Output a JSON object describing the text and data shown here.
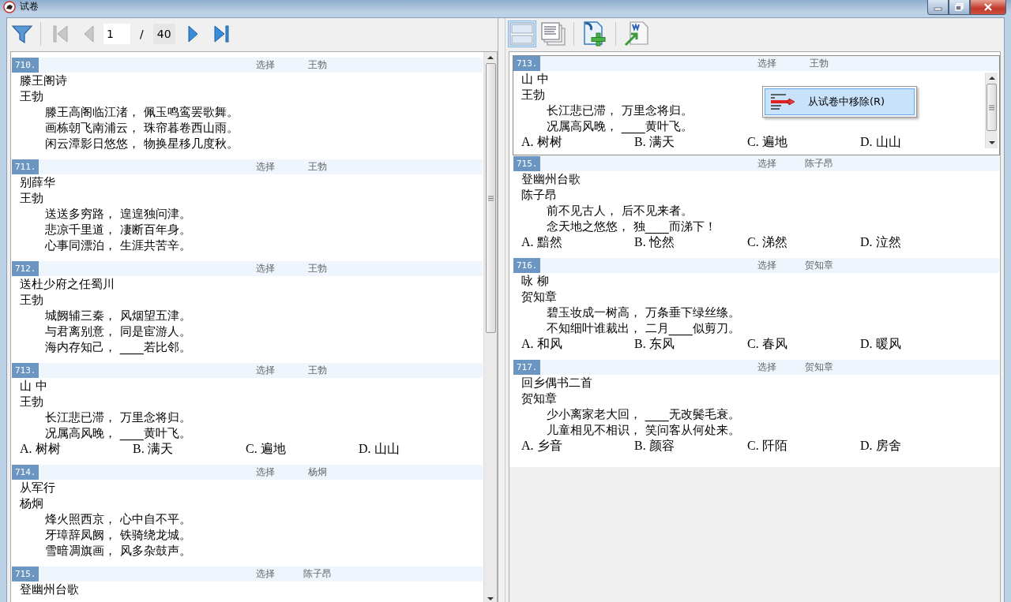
{
  "window": {
    "title": "试卷"
  },
  "left_toolbar": {
    "nav": [
      {
        "kind": "first",
        "disabled": true
      },
      {
        "kind": "prev",
        "disabled": true
      },
      {
        "kind": "next",
        "disabled": false
      },
      {
        "kind": "last",
        "disabled": false
      }
    ],
    "page": "1",
    "separator": "/",
    "page_count": "40"
  },
  "left_questions": [
    {
      "number": "710.",
      "type": "选择",
      "author": "王勃",
      "title": "滕王阁诗",
      "poet": "王勃",
      "lines": [
        "滕王高阁临江渚， 佩玉鸣鸾罢歌舞。",
        "画栋朝飞南浦云， 珠帘暮卷西山雨。",
        "闲云潭影日悠悠， 物换星移几度秋。"
      ],
      "selected": false
    },
    {
      "number": "711.",
      "type": "选择",
      "author": "王勃",
      "title": "别薛华",
      "poet": "王勃",
      "lines": [
        "送送多穷路， 遑遑独问津。",
        "悲凉千里道， 凄断百年身。",
        "心事同漂泊， 生涯共苦辛。"
      ],
      "selected": false
    },
    {
      "number": "712.",
      "type": "选择",
      "author": "王勃",
      "title": "送杜少府之任蜀川",
      "poet": "王勃",
      "lines": [
        "城阙辅三秦， 风烟望五津。",
        "与君离别意， 同是宦游人。",
        "海内存知己， ____若比邻。"
      ],
      "selected": false
    },
    {
      "number": "713.",
      "type": "选择",
      "author": "王勃",
      "title": "山 中",
      "poet": "王勃",
      "lines": [
        "长江悲已滞， 万里念将归。",
        "况属高风晚， ____黄叶飞。"
      ],
      "options": [
        "A. 树树",
        "B. 满天",
        "C. 遍地",
        "D. 山山"
      ],
      "selected": false
    },
    {
      "number": "714.",
      "type": "选择",
      "author": "杨炯",
      "title": "从军行",
      "poet": "杨炯",
      "lines": [
        "烽火照西京， 心中自不平。",
        "牙璋辞凤阙， 铁骑绕龙城。",
        "雪暗凋旗画， 风多杂鼓声。"
      ],
      "selected": false
    },
    {
      "number": "715.",
      "type": "选择",
      "author": "陈子昂",
      "title": "登幽州台歌",
      "selected": false
    }
  ],
  "right_toolbar": {
    "views": [
      {
        "kind": "single",
        "selected": true
      },
      {
        "kind": "pages",
        "selected": false
      }
    ]
  },
  "right_questions": [
    {
      "number": "713.",
      "type": "选择",
      "author": "王勃",
      "title": "山 中",
      "poet": "王勃",
      "lines": [
        "长江悲已滞， 万里念将归。",
        "况属高风晚， ____黄叶飞。"
      ],
      "options": [
        "A. 树树",
        "B. 满天",
        "C. 遍地",
        "D. 山山"
      ],
      "selected": true
    },
    {
      "number": "715.",
      "type": "选择",
      "author": "陈子昂",
      "title": "登幽州台歌",
      "poet": "陈子昂",
      "lines": [
        "前不见古人， 后不见来者。",
        "念天地之悠悠， 独____而涕下！"
      ],
      "options": [
        "A. 黯然",
        "B. 怆然",
        "C. 涕然",
        "D. 泣然"
      ],
      "selected": false
    },
    {
      "number": "716.",
      "type": "选择",
      "author": "贺知章",
      "title": "咏 柳",
      "poet": "贺知章",
      "lines": [
        "碧玉妆成一树高， 万条垂下绿丝绦。",
        "不知细叶谁裁出， 二月____似剪刀。"
      ],
      "options": [
        "A. 和风",
        "B. 东风",
        "C. 春风",
        "D. 暖风"
      ],
      "selected": false
    },
    {
      "number": "717.",
      "type": "选择",
      "author": "贺知章",
      "title": "回乡偶书二首",
      "poet": "贺知章",
      "lines": [
        "少小离家老大回， ____无改鬓毛衰。",
        "儿童相见不相识， 笑问客从何处来。"
      ],
      "options": [
        "A. 乡音",
        "B. 颜容",
        "C. 阡陌",
        "D. 房舍"
      ],
      "selected": false
    }
  ],
  "context_menu": {
    "items": [
      {
        "label": "从试卷中移除(R)",
        "selected": true
      }
    ]
  }
}
